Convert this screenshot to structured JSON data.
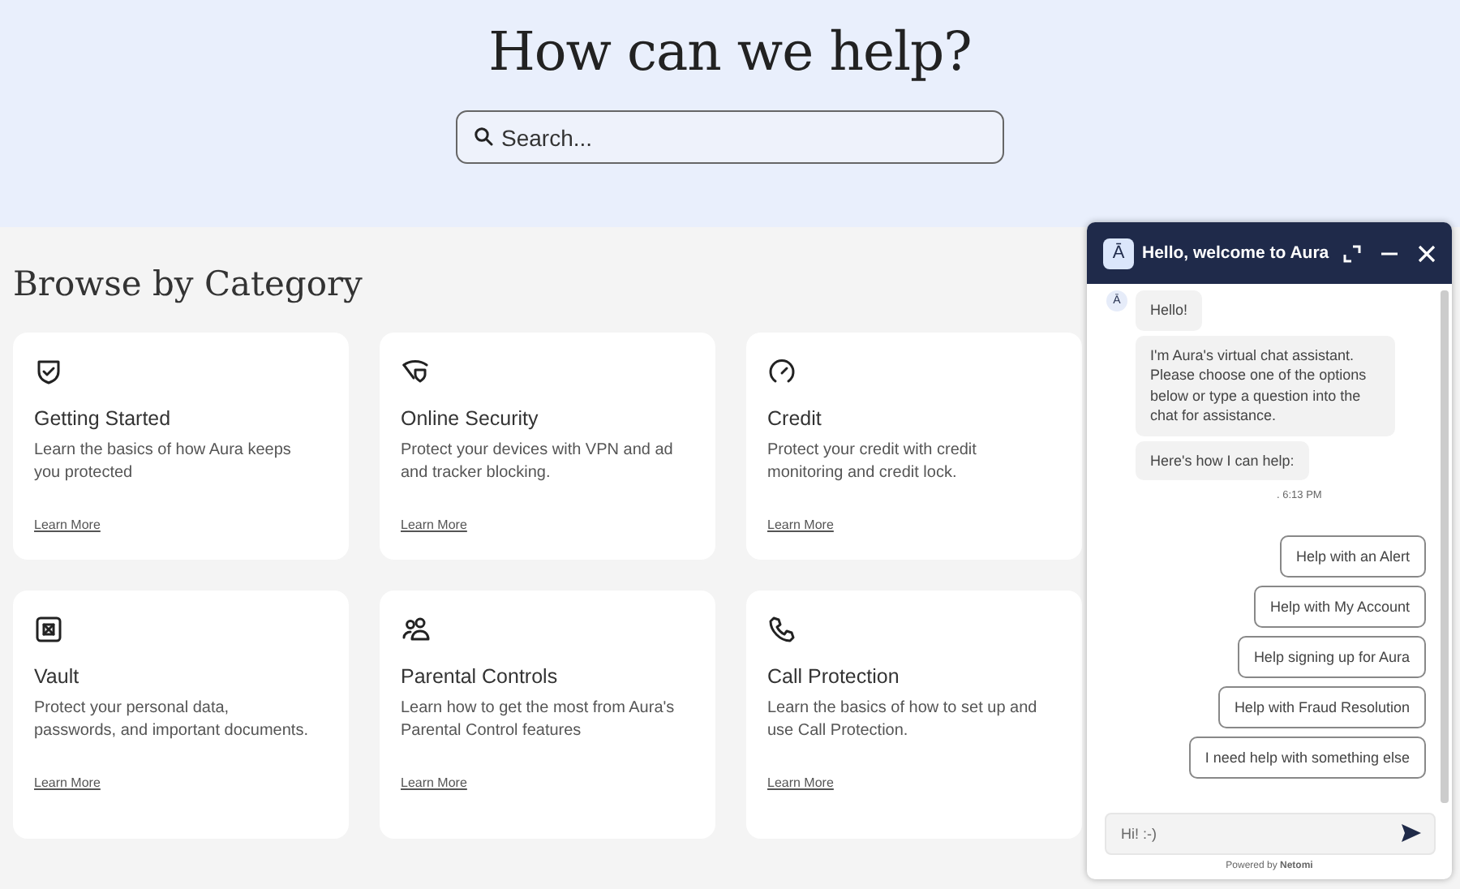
{
  "hero": {
    "title": "How can we help?",
    "search": {
      "placeholder": "Search..."
    }
  },
  "section_title": "Browse by Category",
  "categories": [
    {
      "kind": "shield",
      "title": "Getting Started",
      "description": "Learn the basics of how Aura keeps you protected",
      "link": "Learn More"
    },
    {
      "kind": "eye-shield",
      "title": "Online Security",
      "description": "Protect your devices with VPN and ad and tracker blocking.",
      "link": "Learn More"
    },
    {
      "kind": "gauge",
      "title": "Credit",
      "description": "Protect your credit with credit monitoring and credit lock.",
      "link": "Learn More"
    },
    {
      "kind": "vault",
      "title": "Vault",
      "description": "Protect your personal data, passwords, and important documents.",
      "link": "Learn More"
    },
    {
      "kind": "people",
      "title": "Parental Controls",
      "description": "Learn how to get the most from Aura's Parental Control features",
      "link": "Learn More"
    },
    {
      "kind": "phone",
      "title": "Call Protection",
      "description": "Learn the basics of how to set up and use Call Protection.",
      "link": "Learn More"
    }
  ],
  "chat": {
    "title": "Hello, welcome to Aura",
    "logo": "Ā",
    "avatar": "Ā",
    "messages": [
      "Hello!",
      "I'm Aura's virtual chat assistant. Please choose one of the options below or type a question into the chat for assistance.",
      "Here's how I can help:"
    ],
    "timestamp": ". 6:13 PM",
    "options": [
      "Help with an Alert",
      "Help with My Account",
      "Help signing up for Aura",
      "Help with Fraud Resolution",
      "I need help with something else"
    ],
    "input": {
      "placeholder": "Hi! :-)"
    },
    "footer": "Powered by **Netomi**"
  }
}
